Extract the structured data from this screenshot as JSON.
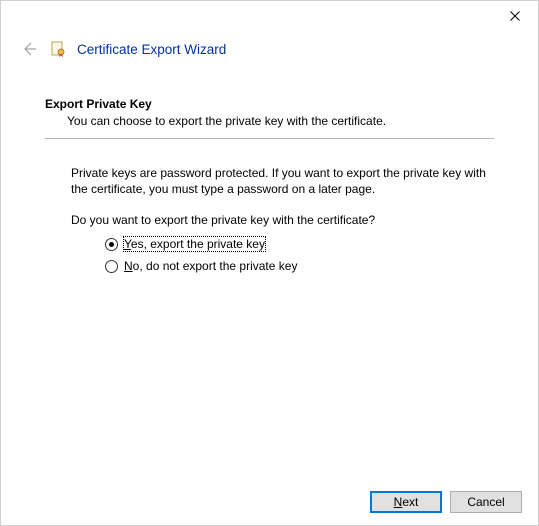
{
  "window": {
    "title": "Certificate Export Wizard"
  },
  "page": {
    "heading": "Export Private Key",
    "subheading": "You can choose to export the private key with the certificate.",
    "body": "Private keys are password protected. If you want to export the private key with the certificate, you must type a password on a later page.",
    "prompt": "Do you want to export the private key with the certificate?"
  },
  "options": {
    "yes_prefix": "Y",
    "yes_rest": "es, export the private key",
    "no_prefix": "N",
    "no_rest": "o, do not export the private key",
    "selected": "yes"
  },
  "buttons": {
    "next_prefix": "N",
    "next_rest": "ext",
    "cancel": "Cancel"
  }
}
